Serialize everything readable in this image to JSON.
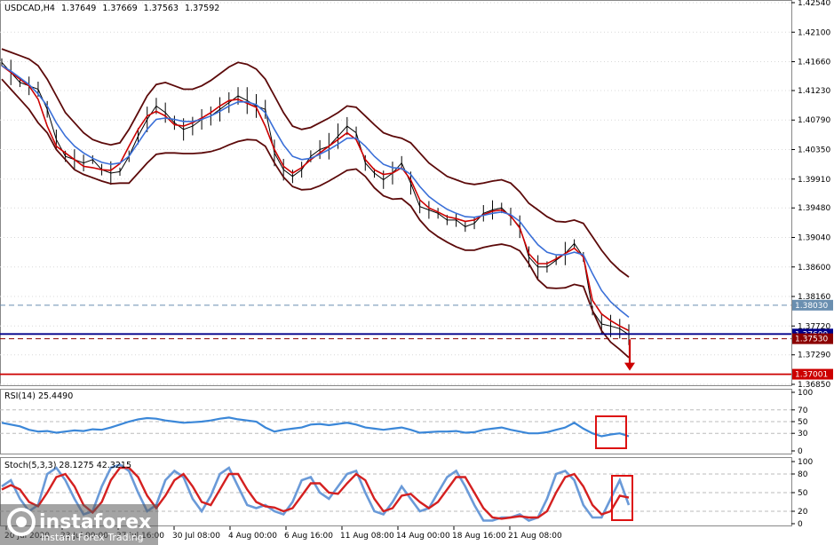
{
  "chart_data": {
    "type": "line",
    "symbol": "USDCAD",
    "timeframe": "H4",
    "ohlc_header": [
      "1.37649",
      "1.37669",
      "1.37563",
      "1.37592"
    ],
    "x_tick_labels": [
      "20 Jul 2020",
      "23 Jul 00:00",
      "27 Jul 16:00",
      "30 Jul 08:00",
      "4 Aug 00:00",
      "6 Aug 16:00",
      "11 Aug 08:00",
      "14 Aug 00:00",
      "18 Aug 16:00",
      "21 Aug 08:00"
    ],
    "price_axis": {
      "ylim": [
        1.3685,
        1.4254
      ],
      "tick_labels": [
        "1.42540",
        "1.42100",
        "1.41660",
        "1.41230",
        "1.40790",
        "1.40350",
        "1.39910",
        "1.39480",
        "1.39040",
        "1.38600",
        "1.38160",
        "1.37720",
        "1.37290",
        "1.36850"
      ]
    },
    "horizontal_levels": [
      {
        "value": "1.38030",
        "color": "#6a8fb0",
        "style": "dashed"
      },
      {
        "value": "1.37600",
        "color": "#00008b",
        "style": "solid"
      },
      {
        "value": "1.37530",
        "color": "#8b0000",
        "style": "dashed"
      },
      {
        "value": "1.37001",
        "color": "#cc0000",
        "style": "solid"
      }
    ],
    "series": [
      {
        "color": "#000000",
        "kind": "close",
        "values": [
          1.4165,
          1.415,
          1.4135,
          1.413,
          1.4125,
          1.4095,
          1.405,
          1.4025,
          1.402,
          1.4015,
          1.402,
          1.4005,
          1.4,
          1.4002,
          1.4025,
          1.4055,
          1.408,
          1.41,
          1.409,
          1.4075,
          1.4065,
          1.407,
          1.408,
          1.4085,
          1.4095,
          1.4105,
          1.4115,
          1.4108,
          1.41,
          1.4095,
          1.403,
          1.4005,
          1.3995,
          1.4005,
          1.4025,
          1.4035,
          1.404,
          1.4055,
          1.407,
          1.406,
          1.4015,
          1.4,
          1.399,
          1.4,
          1.4015,
          1.3985,
          1.395,
          1.3945,
          1.394,
          1.393,
          1.393,
          1.392,
          1.3925,
          1.394,
          1.3945,
          1.3948,
          1.3935,
          1.392,
          1.3875,
          1.386,
          1.386,
          1.387,
          1.388,
          1.3895,
          1.3875,
          1.3795,
          1.3775,
          1.3772,
          1.3768,
          1.3759
        ]
      },
      {
        "color": "#cc0000",
        "kind": "ma-fast",
        "values": [
          1.416,
          1.415,
          1.414,
          1.413,
          1.411,
          1.407,
          1.404,
          1.403,
          1.402,
          1.401,
          1.4008,
          1.4005,
          1.4004,
          1.4014,
          1.404,
          1.4065,
          1.4085,
          1.4092,
          1.4085,
          1.4072,
          1.407,
          1.4075,
          1.4082,
          1.409,
          1.41,
          1.4108,
          1.411,
          1.4104,
          1.4098,
          1.407,
          1.4035,
          1.401,
          1.4,
          1.4008,
          1.402,
          1.403,
          1.404,
          1.405,
          1.406,
          1.405,
          1.402,
          1.4005,
          1.3998,
          1.4,
          1.4008,
          1.399,
          1.396,
          1.3948,
          1.3942,
          1.3935,
          1.3932,
          1.3928,
          1.393,
          1.3938,
          1.3943,
          1.3945,
          1.3936,
          1.3918,
          1.388,
          1.3865,
          1.3865,
          1.3872,
          1.388,
          1.3888,
          1.3875,
          1.381,
          1.379,
          1.378,
          1.3772,
          1.3765
        ]
      },
      {
        "color": "#3a6fd8",
        "kind": "ma-slow",
        "values": [
          1.416,
          1.4152,
          1.4142,
          1.4132,
          1.4118,
          1.41,
          1.4075,
          1.4055,
          1.404,
          1.403,
          1.4022,
          1.4016,
          1.4013,
          1.4015,
          1.4025,
          1.4045,
          1.4065,
          1.408,
          1.4082,
          1.408,
          1.4077,
          1.4077,
          1.408,
          1.4085,
          1.4092,
          1.41,
          1.4106,
          1.4106,
          1.4102,
          1.409,
          1.4065,
          1.4042,
          1.4025,
          1.402,
          1.4022,
          1.4028,
          1.4035,
          1.4043,
          1.4052,
          1.4052,
          1.404,
          1.4025,
          1.4013,
          1.4008,
          1.4007,
          1.3998,
          1.398,
          1.3965,
          1.3955,
          1.3946,
          1.394,
          1.3935,
          1.3934,
          1.3937,
          1.394,
          1.3942,
          1.3938,
          1.3928,
          1.391,
          1.3893,
          1.3882,
          1.3878,
          1.3878,
          1.3882,
          1.3878,
          1.385,
          1.3825,
          1.3808,
          1.3796,
          1.3785
        ]
      },
      {
        "color": "#5c0a0a",
        "kind": "bollinger-upper",
        "values": [
          1.4185,
          1.418,
          1.4175,
          1.417,
          1.416,
          1.414,
          1.4115,
          1.409,
          1.4075,
          1.406,
          1.405,
          1.4045,
          1.4042,
          1.4045,
          1.4065,
          1.409,
          1.4115,
          1.4132,
          1.4135,
          1.413,
          1.4125,
          1.4125,
          1.413,
          1.4138,
          1.4148,
          1.4158,
          1.4165,
          1.4162,
          1.4155,
          1.414,
          1.4115,
          1.409,
          1.407,
          1.4065,
          1.4068,
          1.4075,
          1.4082,
          1.409,
          1.41,
          1.4098,
          1.4085,
          1.4072,
          1.406,
          1.4055,
          1.4052,
          1.4045,
          1.403,
          1.4015,
          1.4005,
          1.3995,
          1.399,
          1.3985,
          1.3983,
          1.3985,
          1.3988,
          1.399,
          1.3985,
          1.3972,
          1.3955,
          1.3945,
          1.3935,
          1.3928,
          1.3927,
          1.393,
          1.3925,
          1.3905,
          1.3885,
          1.3868,
          1.3855,
          1.3845
        ]
      },
      {
        "color": "#5c0a0a",
        "kind": "bollinger-lower",
        "values": [
          1.414,
          1.4125,
          1.411,
          1.4095,
          1.4075,
          1.406,
          1.4035,
          1.402,
          1.4005,
          1.3998,
          1.3993,
          1.3988,
          1.3984,
          1.3985,
          1.3985,
          1.4,
          1.4015,
          1.4028,
          1.403,
          1.403,
          1.4029,
          1.4029,
          1.403,
          1.4032,
          1.4036,
          1.4042,
          1.4047,
          1.405,
          1.4049,
          1.404,
          1.4015,
          1.3994,
          1.398,
          1.3975,
          1.3976,
          1.3981,
          1.3988,
          1.3996,
          1.4004,
          1.4006,
          1.3995,
          1.3978,
          1.3966,
          1.3961,
          1.3962,
          1.3951,
          1.393,
          1.3915,
          1.3905,
          1.3897,
          1.389,
          1.3885,
          1.3885,
          1.3889,
          1.3892,
          1.3894,
          1.3891,
          1.3884,
          1.3865,
          1.3841,
          1.3829,
          1.3828,
          1.3829,
          1.3834,
          1.3831,
          1.3795,
          1.3765,
          1.3748,
          1.3737,
          1.3725
        ]
      }
    ],
    "rsi": {
      "label": "RSI(14) 25.4490",
      "ylim": [
        0,
        100
      ],
      "tick_labels": [
        "100",
        "70",
        "50",
        "30",
        "0"
      ],
      "levels": [
        70,
        50,
        30
      ],
      "values": [
        48,
        45,
        42,
        36,
        33,
        34,
        31,
        33,
        35,
        34,
        37,
        36,
        40,
        45,
        50,
        54,
        56,
        55,
        52,
        50,
        48,
        49,
        50,
        52,
        55,
        57,
        54,
        52,
        50,
        40,
        33,
        36,
        38,
        40,
        45,
        46,
        44,
        46,
        48,
        45,
        40,
        38,
        36,
        38,
        40,
        36,
        31,
        32,
        33,
        33,
        34,
        31,
        32,
        36,
        38,
        40,
        36,
        33,
        30,
        30,
        32,
        36,
        40,
        48,
        38,
        30,
        25,
        28,
        30,
        25
      ]
    },
    "stoch": {
      "label": "Stoch(5,3,3) 28.1275 42.3215",
      "ylim": [
        0,
        100
      ],
      "tick_labels": [
        "100",
        "80",
        "50",
        "20",
        "0"
      ],
      "levels": [
        80,
        50,
        20
      ],
      "k_values": [
        60,
        70,
        40,
        20,
        30,
        80,
        90,
        70,
        40,
        15,
        20,
        60,
        90,
        95,
        85,
        50,
        20,
        30,
        70,
        85,
        75,
        40,
        20,
        45,
        80,
        90,
        60,
        30,
        25,
        30,
        20,
        15,
        35,
        70,
        75,
        50,
        40,
        60,
        80,
        85,
        50,
        20,
        15,
        35,
        60,
        40,
        20,
        25,
        50,
        75,
        85,
        60,
        30,
        5,
        5,
        10,
        10,
        15,
        5,
        10,
        40,
        80,
        85,
        70,
        30,
        10,
        10,
        40,
        70,
        30
      ],
      "d_values": [
        55,
        62,
        55,
        35,
        28,
        50,
        75,
        80,
        60,
        30,
        18,
        35,
        70,
        90,
        90,
        75,
        45,
        25,
        45,
        70,
        80,
        60,
        35,
        30,
        55,
        80,
        80,
        55,
        35,
        28,
        26,
        20,
        25,
        45,
        65,
        65,
        50,
        48,
        65,
        80,
        70,
        40,
        20,
        25,
        45,
        48,
        35,
        25,
        35,
        55,
        75,
        75,
        50,
        25,
        10,
        8,
        10,
        12,
        10,
        10,
        20,
        50,
        75,
        80,
        60,
        30,
        15,
        20,
        45,
        42
      ]
    },
    "highlight_boxes": [
      "rsi-recent",
      "stoch-recent"
    ],
    "forecast_arrow": {
      "color": "#cc0000",
      "direction": "down",
      "target_level": "1.37001"
    },
    "watermark": {
      "brand": "instaforex",
      "tagline": "Instant Forex Trading"
    }
  }
}
